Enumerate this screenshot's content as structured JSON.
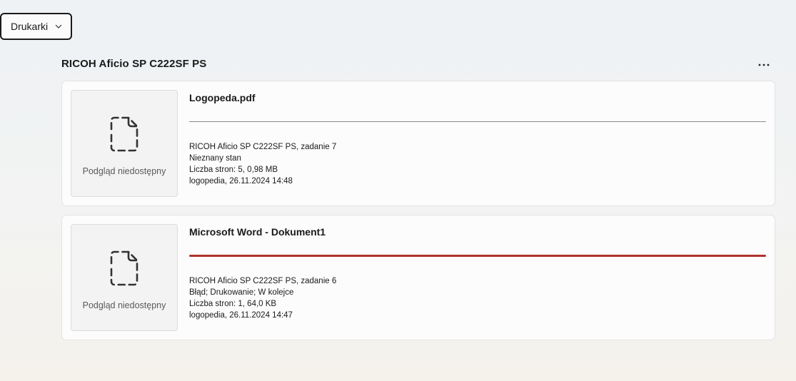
{
  "dropdown": {
    "label": "Drukarki"
  },
  "printer": {
    "name": "RICOH Aficio SP C222SF PS"
  },
  "colors": {
    "error": "#b0342c",
    "neutral_track": "#8a8a8a"
  },
  "jobs": [
    {
      "title": "Logopeda.pdf",
      "preview_label": "Podgląd niedostępny",
      "progress_state": "unknown",
      "progress": 0,
      "details": [
        "RICOH Aficio SP C222SF PS, zadanie 7",
        "Nieznany stan",
        "Liczba stron: 5, 0,98 MB",
        "logopedia, 26.11.2024 14:48"
      ]
    },
    {
      "title": "Microsoft Word - Dokument1",
      "preview_label": "Podgląd niedostępny",
      "progress_state": "error",
      "progress": 1.0,
      "details": [
        "RICOH Aficio SP C222SF PS, zadanie 6",
        "Błąd; Drukowanie; W kolejce",
        "Liczba stron: 1, 64,0 KB",
        "logopedia, 26.11.2024 14:47"
      ]
    }
  ]
}
